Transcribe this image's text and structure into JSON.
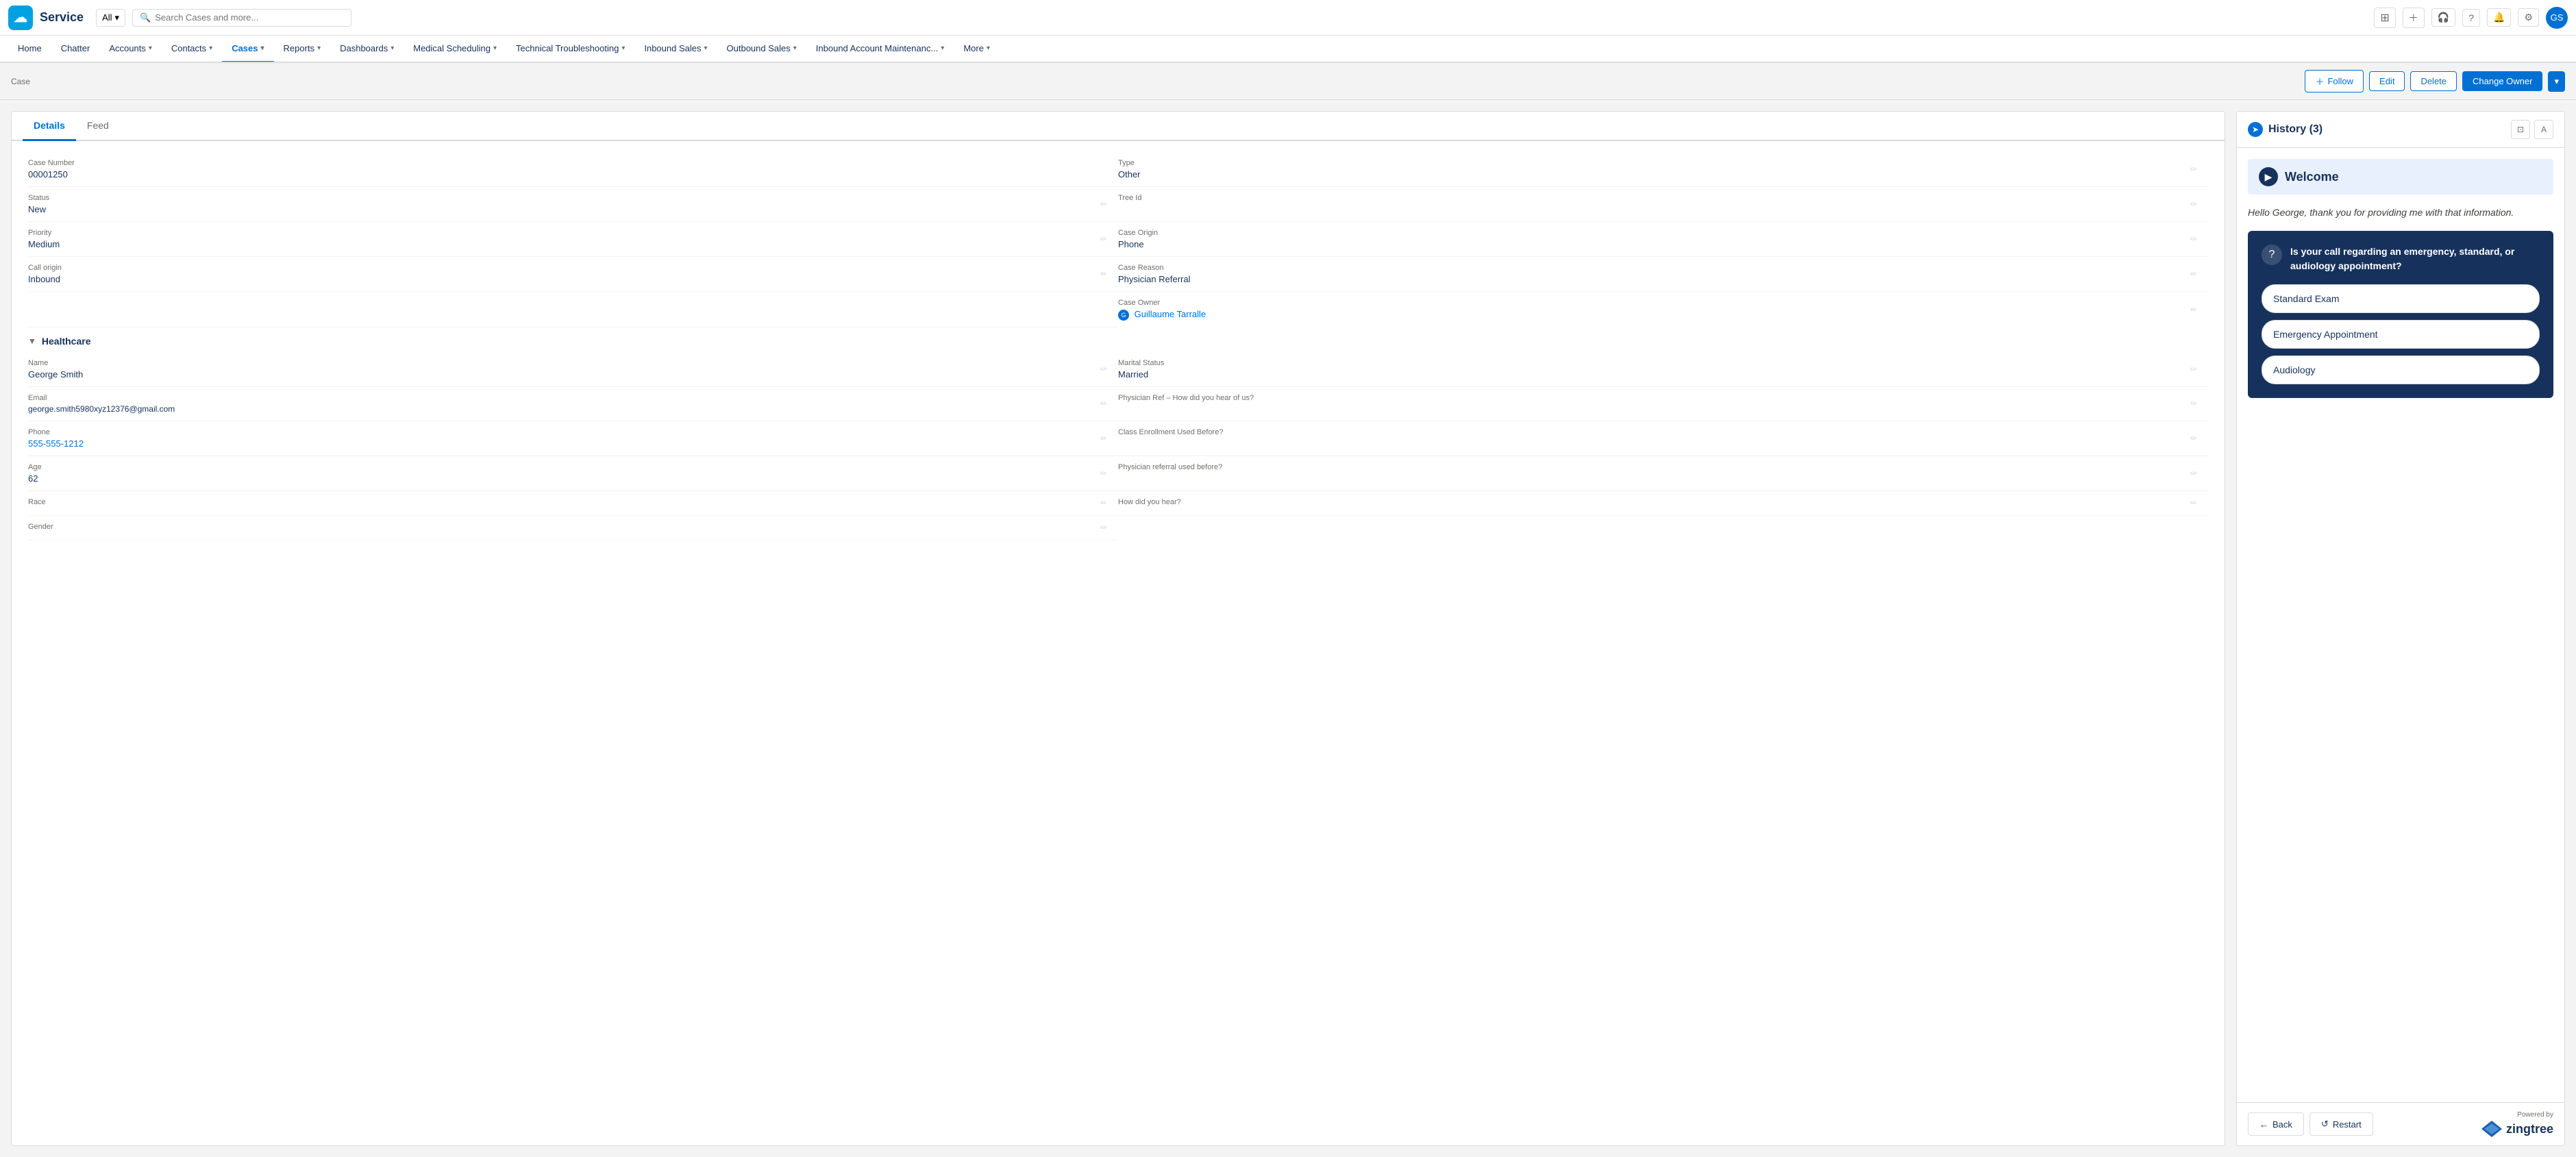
{
  "app": {
    "logo": "☁",
    "name": "Service"
  },
  "topnav": {
    "search_placeholder": "Search Cases and more...",
    "all_label": "All",
    "icons": [
      "grid",
      "plus",
      "headset",
      "question",
      "bell",
      "gear",
      "avatar"
    ],
    "avatar_initials": "GS"
  },
  "secondnav": {
    "items": [
      {
        "label": "Home",
        "active": false,
        "has_dropdown": false
      },
      {
        "label": "Chatter",
        "active": false,
        "has_dropdown": false
      },
      {
        "label": "Accounts",
        "active": false,
        "has_dropdown": true
      },
      {
        "label": "Contacts",
        "active": false,
        "has_dropdown": true
      },
      {
        "label": "Cases",
        "active": true,
        "has_dropdown": true
      },
      {
        "label": "Reports",
        "active": false,
        "has_dropdown": true
      },
      {
        "label": "Dashboards",
        "active": false,
        "has_dropdown": true
      },
      {
        "label": "Medical Scheduling",
        "active": false,
        "has_dropdown": true
      },
      {
        "label": "Technical Troubleshooting",
        "active": false,
        "has_dropdown": true
      },
      {
        "label": "Inbound Sales",
        "active": false,
        "has_dropdown": true
      },
      {
        "label": "Outbound Sales",
        "active": false,
        "has_dropdown": true
      },
      {
        "label": "Inbound Account Maintenanc...",
        "active": false,
        "has_dropdown": true
      },
      {
        "label": "More",
        "active": false,
        "has_dropdown": true
      }
    ]
  },
  "pageheader": {
    "breadcrumb": "Case",
    "actions": {
      "follow": "Follow",
      "edit": "Edit",
      "delete": "Delete",
      "change_owner": "Change Owner"
    }
  },
  "details_tab": "Details",
  "feed_tab": "Feed",
  "fields": {
    "left": [
      {
        "label": "Case Number",
        "value": "00001250",
        "is_link": false
      },
      {
        "label": "Status",
        "value": "New",
        "is_link": false
      },
      {
        "label": "Priority",
        "value": "Medium",
        "is_link": false
      },
      {
        "label": "Call origin",
        "value": "Inbound",
        "is_link": false
      }
    ],
    "right": [
      {
        "label": "Type",
        "value": "Other",
        "is_link": false
      },
      {
        "label": "Tree Id",
        "value": "",
        "is_link": false
      },
      {
        "label": "Case Origin",
        "value": "Phone",
        "is_link": false
      },
      {
        "label": "Case Reason",
        "value": "Physician Referral",
        "is_link": false
      },
      {
        "label": "Case Owner",
        "value": "Guillaume Tarralle",
        "is_link": true
      }
    ]
  },
  "healthcare_section": {
    "title": "Healthcare",
    "fields_left": [
      {
        "label": "Name",
        "value": "George Smith",
        "is_link": false
      },
      {
        "label": "Email",
        "value": "george.smith5980xyz12376@gmail.com",
        "is_link": false
      },
      {
        "label": "Phone",
        "value": "555-555-1212",
        "is_link": true
      },
      {
        "label": "Age",
        "value": "62",
        "is_link": false
      },
      {
        "label": "Race",
        "value": "",
        "is_link": false
      },
      {
        "label": "Gender",
        "value": "",
        "is_link": false
      }
    ],
    "fields_right": [
      {
        "label": "Marital Status",
        "value": "Married",
        "is_link": false
      },
      {
        "label": "Physician Ref – How did you hear of us?",
        "value": "",
        "is_link": false
      },
      {
        "label": "Class Enrollment Used Before?",
        "value": "",
        "is_link": false
      },
      {
        "label": "Physician referral used before?",
        "value": "",
        "is_link": false
      },
      {
        "label": "How did you hear?",
        "value": "",
        "is_link": false
      }
    ]
  },
  "zingtree": {
    "history_label": "History (3)",
    "welcome_title": "Welcome",
    "welcome_text": "Hello George, thank you for providing me with that information.",
    "question": "Is your call regarding an emergency, standard, or audiology appointment?",
    "answers": [
      "Standard Exam",
      "Emergency Appointment",
      "Audiology"
    ],
    "back_btn": "Back",
    "restart_btn": "Restart",
    "powered_by": "Powered by",
    "brand": "zingtree"
  }
}
